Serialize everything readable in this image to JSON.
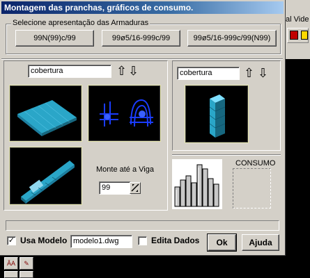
{
  "dialog": {
    "title": "Montagem das pranchas, gráficos de consumo."
  },
  "armaduras": {
    "group_label": "Selecione apresentação das Armaduras",
    "buttons": [
      "99N(99)c/99",
      "99ø5/16-999c/99",
      "99ø5/16-999c/99(N99)"
    ]
  },
  "left_panel": {
    "level_value": "cobertura",
    "monte_label": "Monte até a Viga",
    "viga_value": "99"
  },
  "right_panel": {
    "level_value": "cobertura",
    "consumo_label": "CONSUMO"
  },
  "footer": {
    "usa_modelo_label": "Usa Modelo",
    "usa_modelo_checked": true,
    "modelo_value": "modelo1.dwg",
    "edita_dados_label": "Edita Dados",
    "edita_dados_checked": false,
    "ok_label": "Ok",
    "ajuda_label": "Ajuda"
  },
  "background_app": {
    "menu_text": "al  Vide"
  },
  "icons": [
    "arrow-up-icon",
    "arrow-down-icon",
    "check-icon",
    "spin-icon"
  ],
  "colors": {
    "title_start": "#0a246a",
    "title_end": "#a6caf0",
    "face": "#d4d0c8",
    "model_cyan": "#2aa6c8",
    "model_blue": "#1a3cff"
  }
}
